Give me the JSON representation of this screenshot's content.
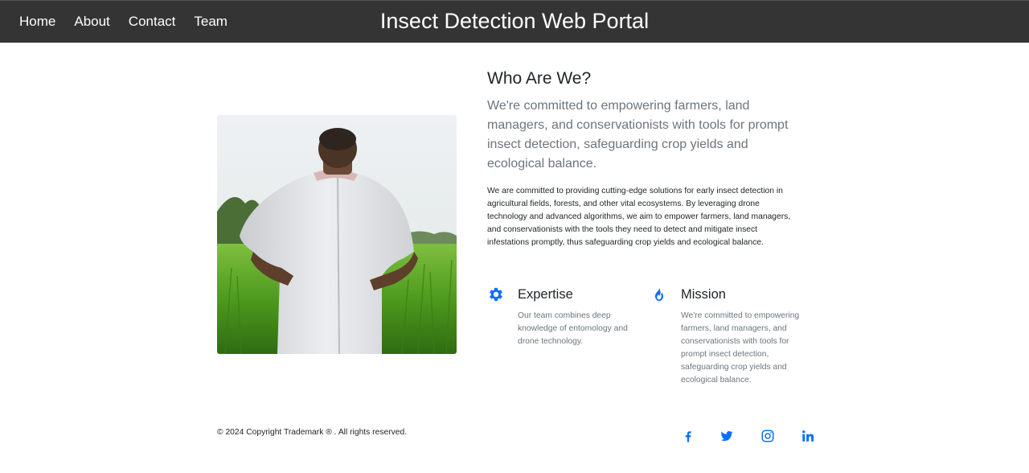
{
  "nav": {
    "links": [
      "Home",
      "About",
      "Contact",
      "Team"
    ],
    "title": "Insect Detection Web Portal"
  },
  "about": {
    "heading": "Who Are We?",
    "lead": "We're committed to empowering farmers, land managers, and conservationists with tools for prompt insect detection, safeguarding crop yields and ecological balance.",
    "body": "We are committed to providing cutting-edge solutions for early insect detection in agricultural fields, forests, and other vital ecosystems. By leveraging drone technology and advanced algorithms, we aim to empower farmers, land managers, and conservationists with the tools they need to detect and mitigate insect infestations promptly, thus safeguarding crop yields and ecological balance."
  },
  "features": [
    {
      "icon": "gear-icon",
      "title": "Expertise",
      "text": "Our team combines deep knowledge of entomology and drone technology."
    },
    {
      "icon": "fire-icon",
      "title": "Mission",
      "text": "We're committed to empowering farmers, land managers, and conservationists with tools for prompt insect detection, safeguarding crop yields and ecological balance."
    }
  ],
  "footer": {
    "copyright": "© 2024 Copyright Trademark ® . All rights reserved.",
    "social": [
      "facebook-icon",
      "twitter-icon",
      "instagram-icon",
      "linkedin-icon"
    ]
  },
  "colors": {
    "navbar": "#343434",
    "accent": "#0d6efd",
    "muted": "#6c757d"
  }
}
